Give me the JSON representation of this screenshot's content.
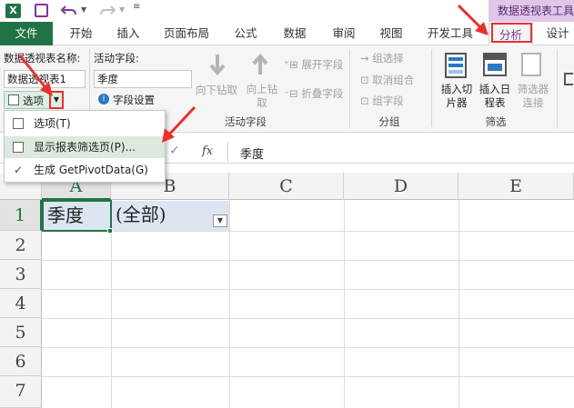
{
  "app": {
    "accent": "#217346",
    "pivot_accent": "#7b3a96"
  },
  "contextual_tab_group": "数据透视表工具",
  "tabs": [
    "文件",
    "开始",
    "插入",
    "页面布局",
    "公式",
    "数据",
    "审阅",
    "视图",
    "开发工具",
    "分析",
    "设计"
  ],
  "ribbon": {
    "pivot_name_label": "数据透视表名称:",
    "pivot_name_value": "数据透视表1",
    "options_label": "选项",
    "active_field_label": "活动字段:",
    "active_field_value": "季度",
    "field_settings": "字段设置",
    "drill_down": "向下钻取",
    "drill_up": "向上钻取",
    "expand_field": "展开字段",
    "collapse_field": "折叠字段",
    "active_field_group": "活动字段",
    "group_selection": "组选择",
    "ungroup": "取消组合",
    "group_field": "组字段",
    "group_group": "分组",
    "insert_slicer": "插入切片器",
    "insert_timeline": "插入日程表",
    "filter_connections": "筛选器连接",
    "filter_group": "筛选"
  },
  "dropdown_menu": {
    "items": [
      {
        "label": "选项(T)",
        "checked": false
      },
      {
        "label": "显示报表筛选页(P)...",
        "checked": false,
        "highlighted": true
      },
      {
        "label": "生成 GetPivotData(G)",
        "checked": true
      }
    ]
  },
  "formula_bar": {
    "fx": "fx",
    "value": "季度"
  },
  "sheet": {
    "columns": [
      "A",
      "B",
      "C",
      "D",
      "E"
    ],
    "rows": [
      "1",
      "2",
      "3",
      "4",
      "5",
      "6",
      "7"
    ],
    "cells": {
      "A1": "季度",
      "B1": "(全部)"
    }
  }
}
